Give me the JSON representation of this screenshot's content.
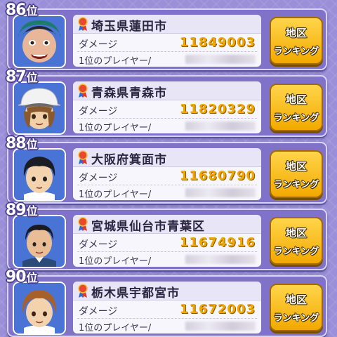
{
  "entries": [
    {
      "rank": "86",
      "rank_suffix": "位",
      "region": "埼玉県蓮田市",
      "damage_label": "ダメージ",
      "damage": "11849003",
      "player_label": "1位のプレイヤー/",
      "button_line1": "地区",
      "button_line2": "ランキング",
      "avatar": "avatar-oni-boy"
    },
    {
      "rank": "87",
      "rank_suffix": "位",
      "region": "青森県青森市",
      "damage_label": "ダメージ",
      "damage": "11820329",
      "player_label": "1位のプレイヤー/",
      "button_line1": "地区",
      "button_line2": "ランキング",
      "avatar": "avatar-hat-boy"
    },
    {
      "rank": "88",
      "rank_suffix": "位",
      "region": "大阪府箕面市",
      "damage_label": "ダメージ",
      "damage": "11680790",
      "player_label": "1位のプレイヤー/",
      "button_line1": "地区",
      "button_line2": "ランキング",
      "avatar": "avatar-dark-hair-boy"
    },
    {
      "rank": "89",
      "rank_suffix": "位",
      "region": "宮城県仙台市青葉区",
      "damage_label": "ダメージ",
      "damage": "11674916",
      "player_label": "1位のプレイヤー/",
      "button_line1": "地区",
      "button_line2": "ランキング",
      "avatar": "avatar-man"
    },
    {
      "rank": "90",
      "rank_suffix": "位",
      "region": "栃木県宇都宮市",
      "damage_label": "ダメージ",
      "damage": "11672003",
      "player_label": "1位のプレイヤー/",
      "button_line1": "地区",
      "button_line2": "ランキング",
      "avatar": "avatar-brown-hair-girl"
    }
  ],
  "colors": {
    "card_bg": "#7f72c8",
    "damage_value": "#f2a800",
    "button": "#ffc51f",
    "avatar_bg": "#4a73d6"
  }
}
